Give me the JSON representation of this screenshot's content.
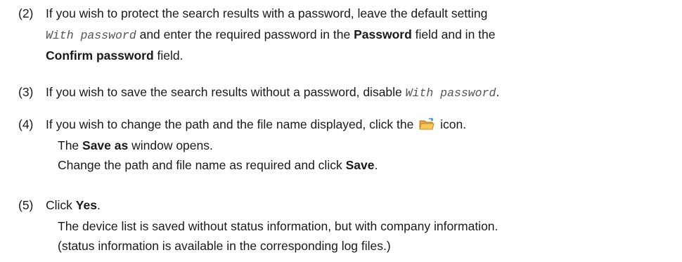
{
  "steps": [
    {
      "number": "(2)",
      "l1_a": "If you wish to protect the search results with a password, leave the default setting",
      "l2_code": "With password",
      "l2_a": " and enter the required password in the ",
      "l2_bold": "Password",
      "l2_b": " field and in the",
      "l3_bold": "Confirm password",
      "l3_a": " field."
    },
    {
      "number": "(3)",
      "l1_a": "If you wish to save the search results without a password, disable ",
      "l1_code": "With password",
      "l1_b": "."
    },
    {
      "number": "(4)",
      "l1_a": "If you wish to change the path and the file name displayed, click the ",
      "l1_icon": "folder-open-icon",
      "l1_b": " icon.",
      "sub1_bold": "Save as",
      "sub1_a": " window opens.",
      "sub1_pre": "The ",
      "sub2_a": "Change the path and file name as required and click ",
      "sub2_bold": "Save",
      "sub2_b": "."
    },
    {
      "number": "(5)",
      "l1_a": "Click ",
      "l1_bold": "Yes",
      "l1_b": ".",
      "sub1": "The device list is saved without status information, but with company information.",
      "sub2": "(status information is available in the corresponding log files.)"
    }
  ]
}
